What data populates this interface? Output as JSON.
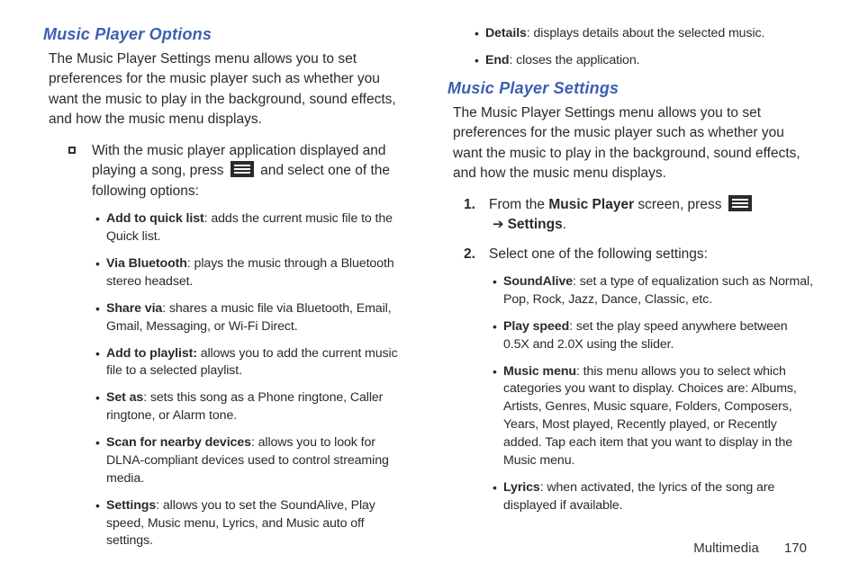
{
  "left": {
    "heading": "Music Player Options",
    "intro": "The Music Player Settings menu allows you to set preferences for the music player such as whether you want the music to play in the background, sound effects, and how the music menu displays.",
    "lead_pre": "With the music player application displayed and playing a song, press ",
    "lead_post": " and select one of the following options:",
    "items": [
      {
        "term": "Add to quick list",
        "desc": ": adds the current music file to the Quick list."
      },
      {
        "term": "Via Bluetooth",
        "desc": ": plays the music through a Bluetooth stereo headset."
      },
      {
        "term": "Share via",
        "desc": ": shares a music file via Bluetooth, Email, Gmail, Messaging, or Wi-Fi Direct."
      },
      {
        "term": "Add to playlist:",
        "desc": " allows you to add the current music file to a selected playlist."
      },
      {
        "term": "Set as",
        "desc": ": sets this song as a Phone ringtone, Caller ringtone, or Alarm tone."
      },
      {
        "term": "Scan for nearby devices",
        "desc": ": allows you to look for DLNA-compliant devices used to control streaming media."
      },
      {
        "term": "Settings",
        "desc": ": allows you to set the SoundAlive, Play speed, Music menu, Lyrics, and Music auto off settings."
      }
    ]
  },
  "right": {
    "top_items": [
      {
        "term": "Details",
        "desc": ": displays details about the selected music."
      },
      {
        "term": "End",
        "desc": ": closes the application."
      }
    ],
    "heading": "Music Player Settings",
    "intro": "The Music Player Settings menu allows you to set preferences for the music player such as whether you want the music to play in the background, sound effects, and how the music menu displays.",
    "step1_pre": "From the ",
    "step1_mp": "Music Player",
    "step1_mid": " screen, press ",
    "step1_arrow": "➔",
    "step1_settings": "Settings",
    "step1_end": ".",
    "step2": "Select one of the following settings:",
    "num1": "1.",
    "num2": "2.",
    "items": [
      {
        "term": "SoundAlive",
        "desc": ": set a type of equalization such as Normal, Pop, Rock, Jazz, Dance, Classic, etc."
      },
      {
        "term": "Play speed",
        "desc": ": set the play speed anywhere between 0.5X and 2.0X using the slider."
      },
      {
        "term": "Music menu",
        "desc": ": this menu allows you to select which categories you want to display. Choices are: Albums, Artists, Genres, Music square, Folders, Composers, Years, Most played, Recently played, or Recently added. Tap each item that you want to display in the Music menu."
      },
      {
        "term": "Lyrics",
        "desc": ": when activated, the lyrics of the song are displayed if available."
      }
    ]
  },
  "footer": {
    "section": "Multimedia",
    "page": "170"
  }
}
